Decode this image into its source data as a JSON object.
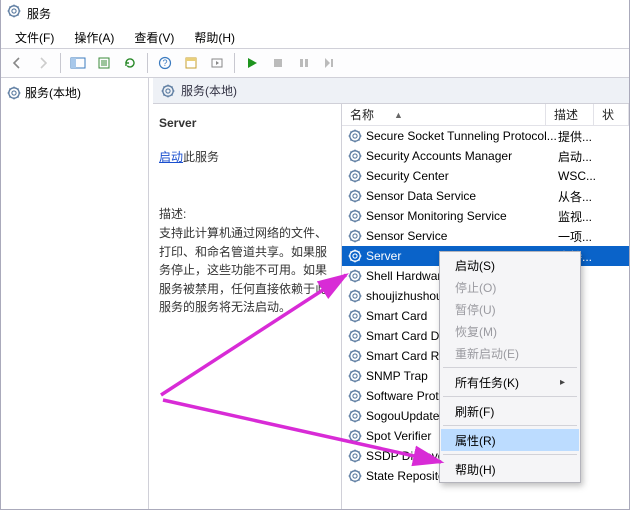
{
  "window": {
    "title": "服务"
  },
  "menu": {
    "file": "文件(F)",
    "action": "操作(A)",
    "view": "查看(V)",
    "help": "帮助(H)"
  },
  "tree": {
    "root": "服务(本地)"
  },
  "right_header": "服务(本地)",
  "detail": {
    "title": "Server",
    "start_link": "启动",
    "start_suffix": "此服务",
    "desc_label": "描述:",
    "desc": "支持此计算机通过网络的文件、打印、和命名管道共享。如果服务停止，这些功能不可用。如果服务被禁用，任何直接依赖于此服务的服务将无法启动。"
  },
  "columns": {
    "name": "名称",
    "desc": "描述",
    "third": "状"
  },
  "services": [
    {
      "name": "Secure Socket Tunneling Protocol...",
      "desc": "提供..."
    },
    {
      "name": "Security Accounts Manager",
      "desc": "启动..."
    },
    {
      "name": "Security Center",
      "desc": "WSC..."
    },
    {
      "name": "Sensor Data Service",
      "desc": "从各..."
    },
    {
      "name": "Sensor Monitoring Service",
      "desc": "监视..."
    },
    {
      "name": "Sensor Service",
      "desc": "一项..."
    },
    {
      "name": "Server",
      "desc": "支持...",
      "sel": true
    },
    {
      "name": "Shell Hardware",
      "desc": "..."
    },
    {
      "name": "shoujizhushou",
      "desc": "..."
    },
    {
      "name": "Smart Card",
      "desc": "..."
    },
    {
      "name": "Smart Card D",
      "desc": "..."
    },
    {
      "name": "Smart Card R",
      "desc": "..."
    },
    {
      "name": "SNMP Trap",
      "desc": "..."
    },
    {
      "name": "Software Prot",
      "desc": "..."
    },
    {
      "name": "SogouUpdate",
      "desc": ""
    },
    {
      "name": "Spot Verifier",
      "desc": "..."
    },
    {
      "name": "SSDP Discove",
      "desc": "..."
    },
    {
      "name": "State Repository Service",
      "desc": "..."
    }
  ],
  "ctx": {
    "start": "启动(S)",
    "stop": "停止(O)",
    "pause": "暂停(U)",
    "resume": "恢复(M)",
    "restart": "重新启动(E)",
    "alltasks": "所有任务(K)",
    "refresh": "刷新(F)",
    "properties": "属性(R)",
    "help": "帮助(H)"
  }
}
